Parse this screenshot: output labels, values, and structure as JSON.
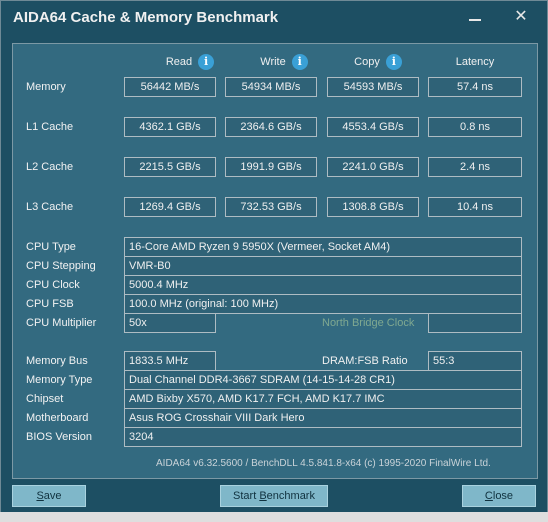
{
  "window": {
    "title": "AIDA64 Cache & Memory Benchmark",
    "close_glyph": "✕"
  },
  "columns": {
    "read": "Read",
    "write": "Write",
    "copy": "Copy",
    "latency": "Latency",
    "info_glyph": "i"
  },
  "benchmarks": [
    {
      "label": "Memory",
      "read": "56442 MB/s",
      "write": "54934 MB/s",
      "copy": "54593 MB/s",
      "latency": "57.4 ns"
    },
    {
      "label": "L1 Cache",
      "read": "4362.1 GB/s",
      "write": "2364.6 GB/s",
      "copy": "4553.4 GB/s",
      "latency": "0.8 ns"
    },
    {
      "label": "L2 Cache",
      "read": "2215.5 GB/s",
      "write": "1991.9 GB/s",
      "copy": "2241.0 GB/s",
      "latency": "2.4 ns"
    },
    {
      "label": "L3 Cache",
      "read": "1269.4 GB/s",
      "write": "732.53 GB/s",
      "copy": "1308.8 GB/s",
      "latency": "10.4 ns"
    }
  ],
  "cpu": {
    "type_label": "CPU Type",
    "type": "16-Core AMD Ryzen 9 5950X  (Vermeer, Socket AM4)",
    "stepping_label": "CPU Stepping",
    "stepping": "VMR-B0",
    "clock_label": "CPU Clock",
    "clock": "5000.4 MHz",
    "fsb_label": "CPU FSB",
    "fsb": "100.0 MHz  (original: 100 MHz)",
    "multiplier_label": "CPU Multiplier",
    "multiplier": "50x",
    "north_bridge_label": "North Bridge Clock",
    "north_bridge": ""
  },
  "memory": {
    "bus_label": "Memory Bus",
    "bus": "1833.5 MHz",
    "dram_fsb_label": "DRAM:FSB Ratio",
    "dram_fsb": "55:3",
    "type_label": "Memory Type",
    "type": "Dual Channel DDR4-3667 SDRAM  (14-15-14-28 CR1)",
    "chipset_label": "Chipset",
    "chipset": "AMD Bixby X570, AMD K17.7 FCH, AMD K17.7 IMC",
    "motherboard_label": "Motherboard",
    "motherboard": "Asus ROG Crosshair VIII Dark Hero",
    "bios_label": "BIOS Version",
    "bios": "3204"
  },
  "footer": "AIDA64 v6.32.5600 / BenchDLL 4.5.841.8-x64  (c) 1995-2020 FinalWire Ltd.",
  "buttons": {
    "save_first": "S",
    "save_rest": "ave",
    "start_first": "Start ",
    "start_u": "B",
    "start_rest": "enchmark",
    "close_first": "C",
    "close_rest": "lose"
  }
}
